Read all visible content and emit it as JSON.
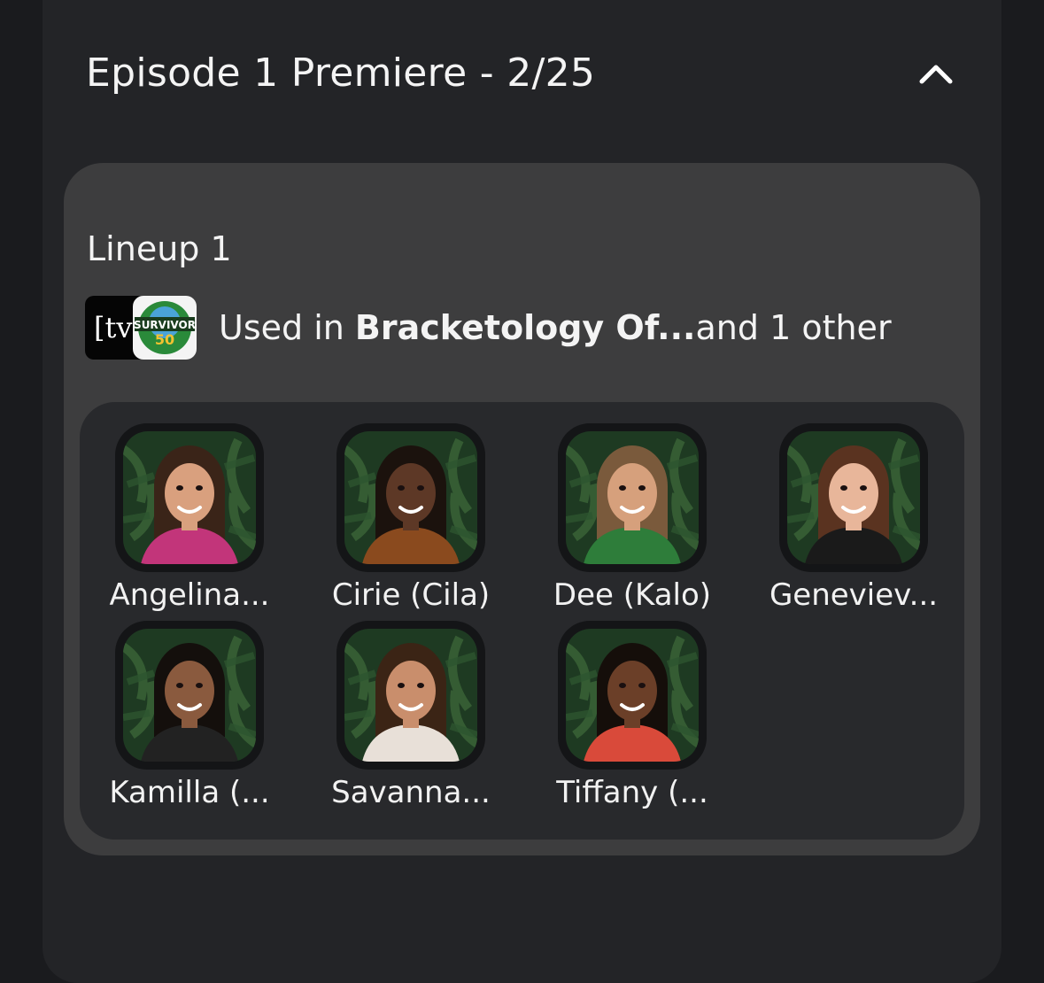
{
  "episode": {
    "title": "Episode 1 Premiere - 2/25",
    "toggle_icon": "chevron-up-icon"
  },
  "lineup": {
    "title": "Lineup 1",
    "used_prefix": "Used in ",
    "used_league": "Bracketology Of...",
    "used_suffix": "and 1 other",
    "logos": {
      "tv_text": "[tv",
      "survivor_text": "SURVIVOR",
      "survivor_number": "50"
    }
  },
  "players": [
    {
      "name": "Angelina...",
      "hair": "#3a2418",
      "skin": "#d9a07e",
      "top": "#c2357a"
    },
    {
      "name": "Cirie (Cila)",
      "hair": "#1b120d",
      "skin": "#5d3826",
      "top": "#8a4a1e"
    },
    {
      "name": "Dee (Kalo)",
      "hair": "#7a5a3c",
      "skin": "#d6a07c",
      "top": "#2e7d3a"
    },
    {
      "name": "Geneviev...",
      "hair": "#5a3320",
      "skin": "#e8b69a",
      "top": "#1a1a1a"
    },
    {
      "name": "Kamilla (...",
      "hair": "#140f0c",
      "skin": "#8a5a3e",
      "top": "#222222"
    },
    {
      "name": "Savanna...",
      "hair": "#3b2415",
      "skin": "#c98e6c",
      "top": "#e8e0d8"
    },
    {
      "name": "Tiffany (...",
      "hair": "#150e0a",
      "skin": "#6b3f28",
      "top": "#d94a3a"
    }
  ],
  "colors": {
    "background": "#1a1b1e",
    "card": "#232427",
    "lineup_card": "#3d3d3e",
    "roster_panel": "#28292c",
    "jungle": "#1e3a22"
  }
}
